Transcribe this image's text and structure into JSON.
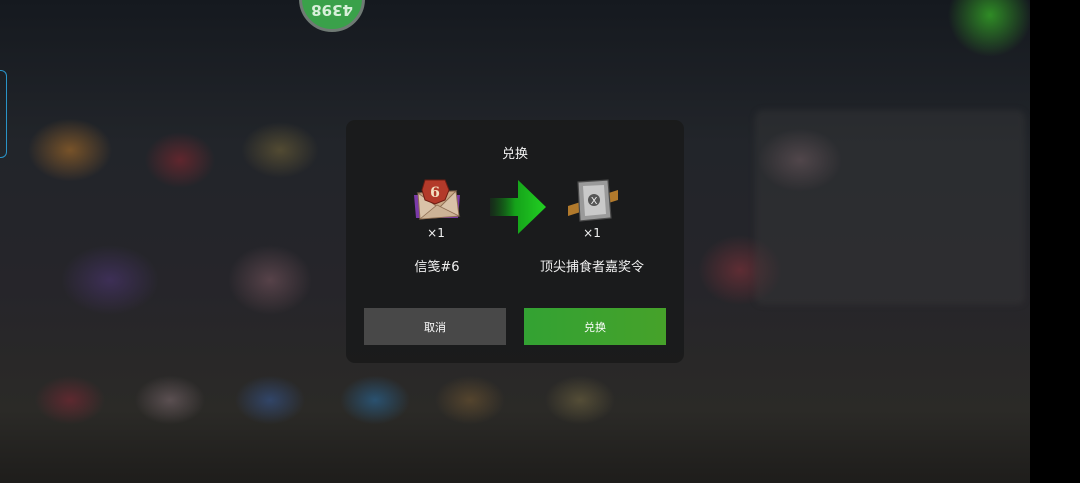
{
  "background": {
    "badge_text": "4398"
  },
  "dialog": {
    "title": "兑换",
    "from_item": {
      "name": "信笺#6",
      "quantity": "×1",
      "icon": "letter-envelope-icon",
      "number": "6"
    },
    "to_item": {
      "name": "顶尖捕食者嘉奖令",
      "quantity": "×1",
      "icon": "commendation-token-icon",
      "mark": "X"
    },
    "buttons": {
      "cancel_label": "取消",
      "confirm_label": "兑换"
    }
  },
  "colors": {
    "confirm_green": "#3fa22c",
    "cancel_gray": "#484848",
    "arrow_green": "#1fc51f",
    "dialog_bg": "#1a1b1b"
  }
}
